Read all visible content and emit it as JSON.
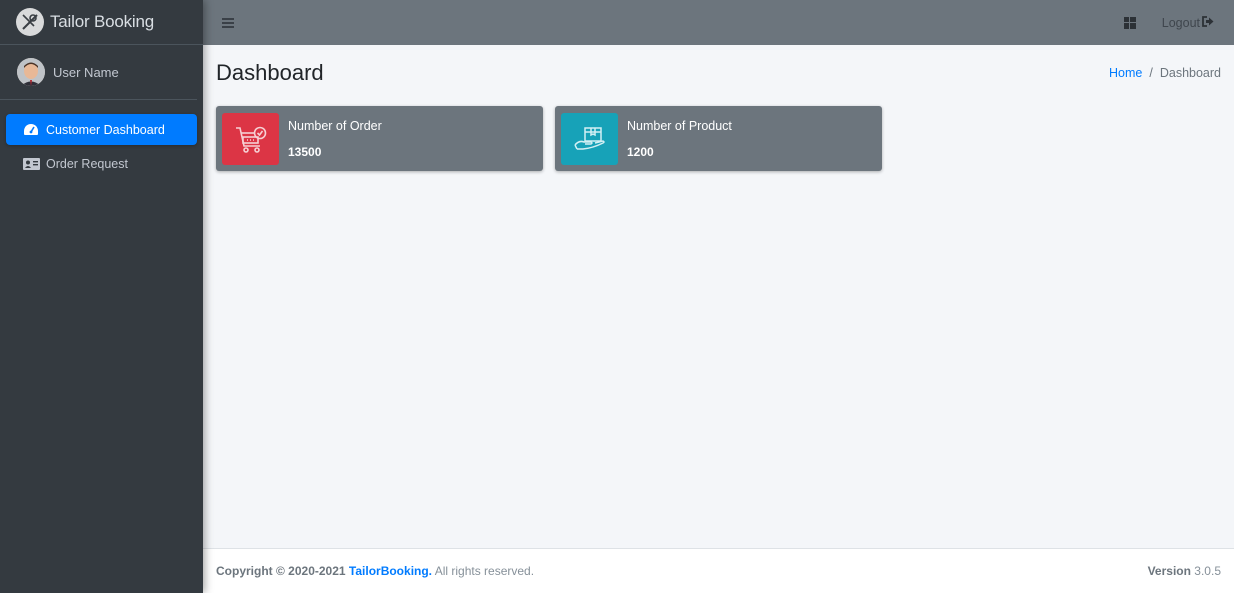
{
  "brand": {
    "title": "Tailor Booking",
    "logo_icon": "tailor-logo-icon"
  },
  "user": {
    "name": "User Name",
    "avatar_icon": "user-avatar"
  },
  "sidebar": {
    "items": [
      {
        "label": "Customer Dashboard",
        "icon": "tachometer-icon",
        "active": true
      },
      {
        "label": "Order Request",
        "icon": "id-card-icon",
        "active": false
      }
    ]
  },
  "topbar": {
    "menu_icon": "hamburger-icon",
    "apps_icon": "grid-icon",
    "logout_label": "Logout",
    "logout_icon": "sign-out-icon"
  },
  "page": {
    "title": "Dashboard",
    "breadcrumb": [
      {
        "label": "Home",
        "link": true
      },
      {
        "label": "Dashboard",
        "link": false
      }
    ],
    "breadcrumb_separator": "/"
  },
  "info_boxes": [
    {
      "label": "Number of Order",
      "value": "13500",
      "icon": "cart-check-icon",
      "color": "#dc3545"
    },
    {
      "label": "Number of Product",
      "value": "1200",
      "icon": "hand-box-icon",
      "color": "#17a2b8"
    }
  ],
  "footer": {
    "copyright_prefix": "Copyright © 2020-2021",
    "brand_link": "TailorBooking.",
    "rights": "All rights reserved.",
    "version_label": "Version",
    "version_value": "3.0.5"
  },
  "colors": {
    "sidebar_bg": "#343a40",
    "topbar_bg": "#6c757d",
    "accent": "#007bff",
    "danger": "#dc3545",
    "info": "#17a2b8"
  }
}
